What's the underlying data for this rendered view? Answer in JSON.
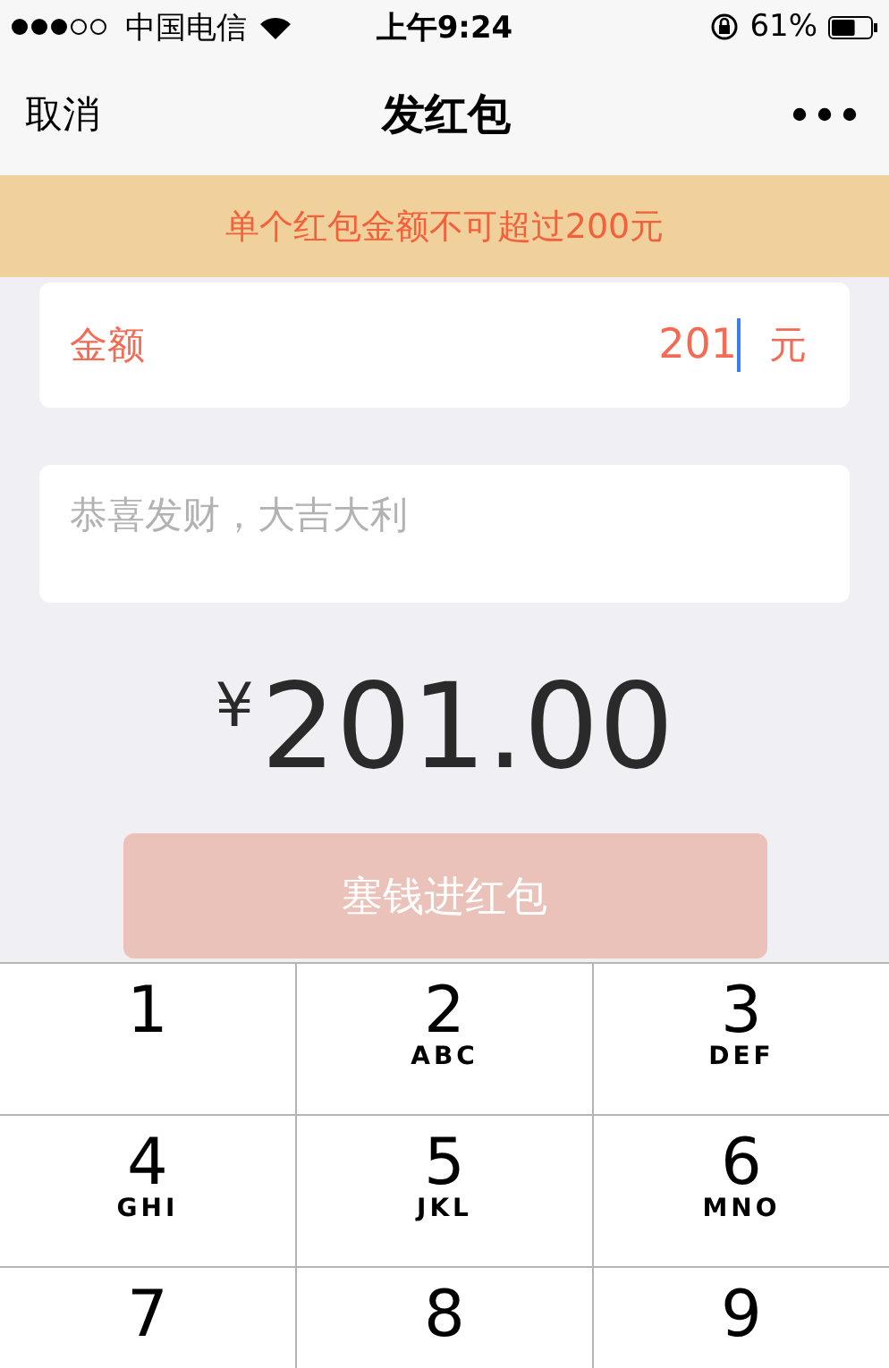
{
  "status_bar": {
    "carrier": "中国电信",
    "time": "上午9:24",
    "battery": "61%"
  },
  "nav": {
    "cancel": "取消",
    "title": "发红包"
  },
  "warning": "单个红包金额不可超过200元",
  "amount_field": {
    "label": "金额",
    "value": "201",
    "unit": "元",
    "error": true
  },
  "message_field": {
    "placeholder": "恭喜发财，大吉大利"
  },
  "total": {
    "currency": "¥",
    "amount": "201.00"
  },
  "submit": {
    "label": "塞钱进红包",
    "disabled": true
  },
  "keypad": [
    {
      "digit": "1"
    },
    {
      "digit": "2",
      "letters": "ABC"
    },
    {
      "digit": "3",
      "letters": "DEF"
    },
    {
      "digit": "4",
      "letters": "GHI"
    },
    {
      "digit": "5",
      "letters": "JKL"
    },
    {
      "digit": "6",
      "letters": "MNO"
    },
    {
      "digit": "7"
    },
    {
      "digit": "8"
    },
    {
      "digit": "9"
    }
  ]
}
